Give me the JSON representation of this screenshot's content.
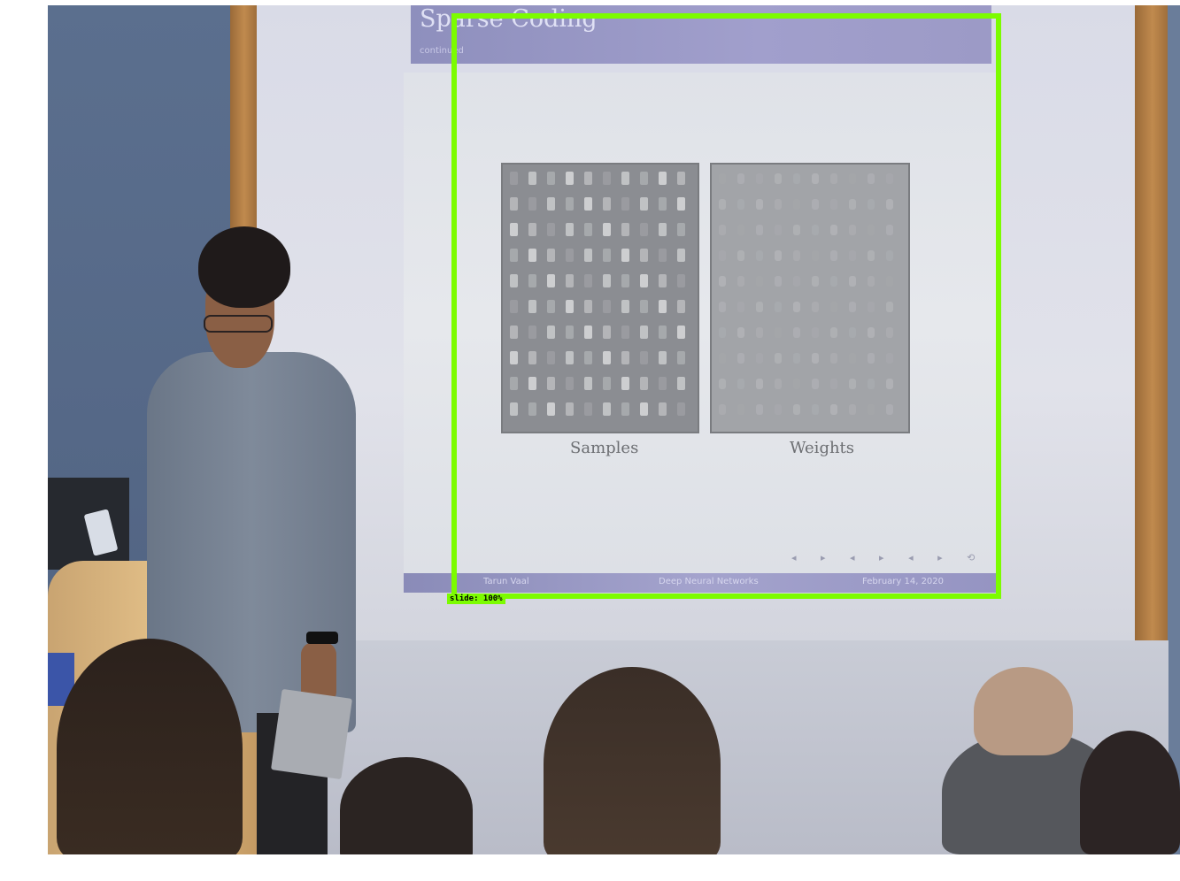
{
  "slide": {
    "title": "Sparse Coding",
    "subtitle": "continued",
    "caption_left": "Samples",
    "caption_right": "Weights",
    "footer_left": "Tarun Vaal",
    "footer_center": "Deep Neural Networks",
    "footer_right": "February 14, 2020"
  },
  "detection": {
    "label": "slide: 100%",
    "color": "#7cfc00"
  }
}
